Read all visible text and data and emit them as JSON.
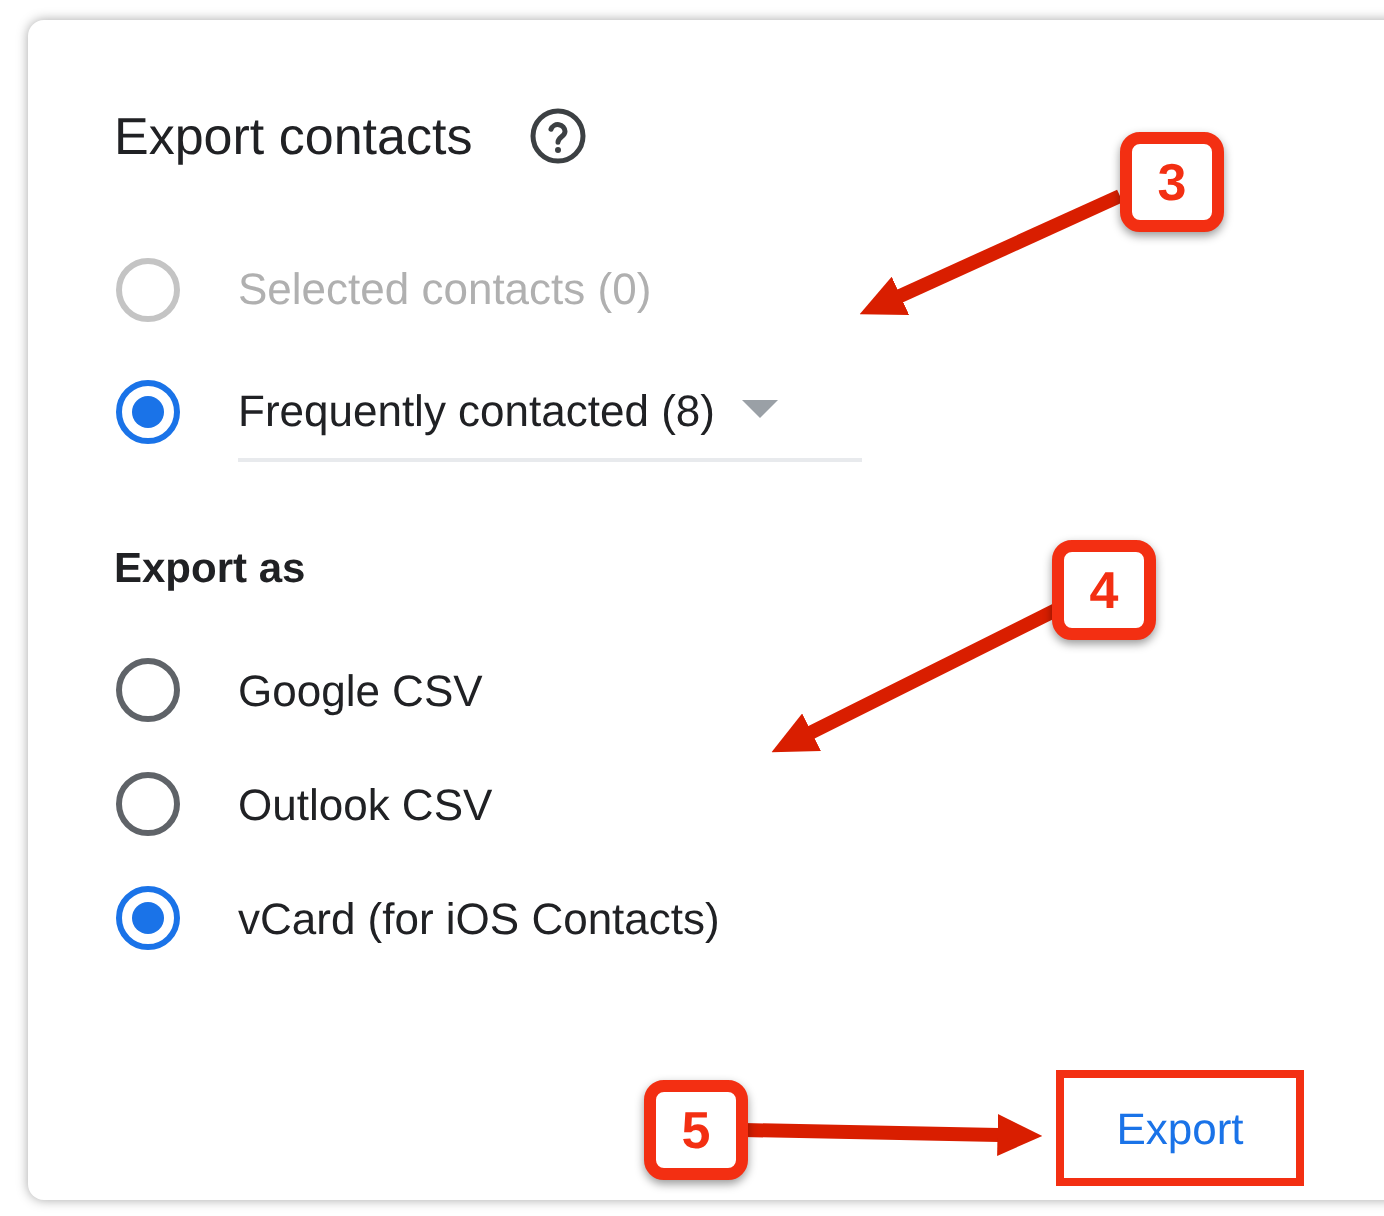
{
  "dialog": {
    "title": "Export contacts",
    "scope_options": [
      {
        "label": "Selected contacts (0)",
        "selected": false,
        "disabled": true,
        "kind": "plain"
      },
      {
        "label": "Frequently contacted (8)",
        "selected": true,
        "disabled": false,
        "kind": "dropdown"
      }
    ],
    "format_heading": "Export as",
    "format_options": [
      {
        "label": "Google CSV",
        "selected": false
      },
      {
        "label": "Outlook CSV",
        "selected": false
      },
      {
        "label": "vCard (for iOS Contacts)",
        "selected": true
      }
    ],
    "export_button": {
      "label": "Export",
      "highlighted": true
    }
  },
  "callouts": [
    {
      "label": "3"
    },
    {
      "label": "4"
    },
    {
      "label": "5"
    }
  ]
}
